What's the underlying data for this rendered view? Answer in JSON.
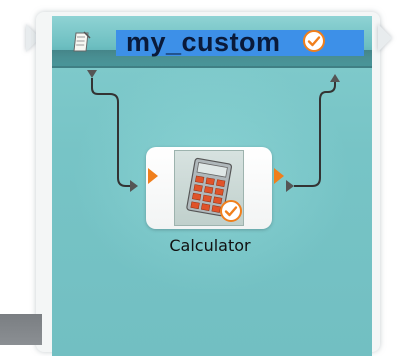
{
  "metanode": {
    "title": "my_custom",
    "title_status": "configured",
    "note_icon": "note-icon",
    "check_icon": "check-icon"
  },
  "node": {
    "label": "Calculator",
    "icon": "calculator-icon",
    "status": "configured"
  },
  "colors": {
    "teal": "#78c5c7",
    "title_highlight": "#3d90e8",
    "port_orange": "#f07f1c",
    "check_orange": "#f07f1c"
  }
}
